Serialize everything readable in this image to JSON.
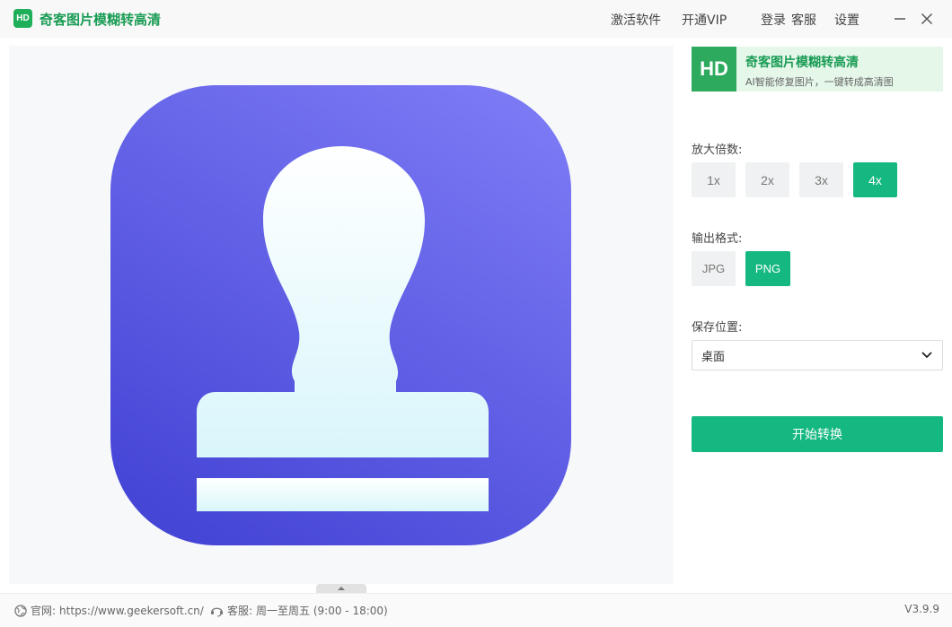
{
  "app": {
    "logo_text": "HD",
    "title": "奇客图片模糊转高清"
  },
  "menu": {
    "activate": "激活软件",
    "vip": "开通VIP",
    "login": "登录",
    "service": "客服",
    "settings": "设置"
  },
  "banner": {
    "badge": "HD",
    "title": "奇客图片模糊转高清",
    "subtitle": "AI智能修复图片，一键转成高清图"
  },
  "scale": {
    "label": "放大倍数:",
    "options": [
      "1x",
      "2x",
      "3x",
      "4x"
    ],
    "selected": "4x"
  },
  "format": {
    "label": "输出格式:",
    "options": [
      "JPG",
      "PNG"
    ],
    "selected": "PNG"
  },
  "save": {
    "label": "保存位置:",
    "value": "桌面"
  },
  "start_button": "开始转换",
  "footer": {
    "website_label": "官网:",
    "website_url": "https://www.geekersoft.cn/",
    "service_label": "客服:",
    "service_hours": "周一至周五 (9:00 - 18:00)",
    "version": "V3.9.9"
  },
  "colors": {
    "accent": "#16b881",
    "brand_green": "#1a9c55",
    "icon_gradient_top": "#7b79f4",
    "icon_gradient_bottom": "#4545d6"
  },
  "icons": {
    "preview": "stamp-icon",
    "minimize": "minimize-icon",
    "close": "close-icon",
    "dropdown": "chevron-down-icon",
    "collapse": "chevron-up-icon",
    "website": "globe-icon",
    "service": "headset-icon"
  }
}
